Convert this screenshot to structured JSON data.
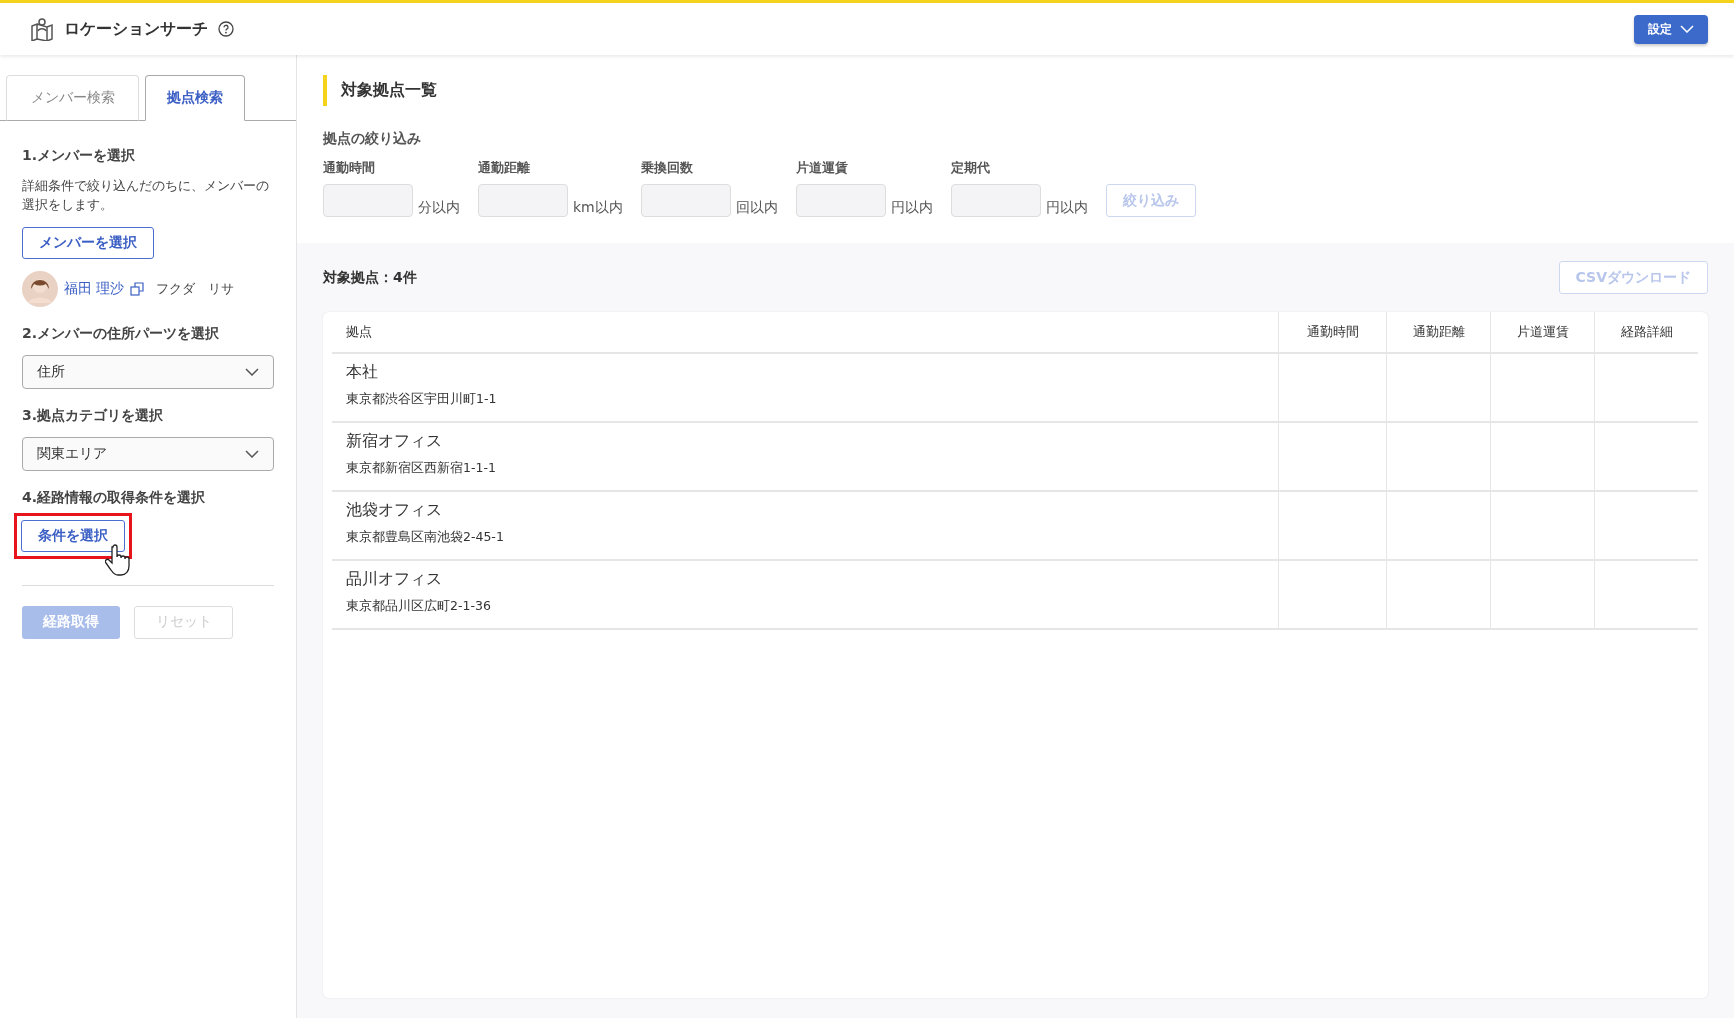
{
  "header": {
    "title": "ロケーションサーチ",
    "settings_button": "設定"
  },
  "tabs": [
    {
      "label": "メンバー検索",
      "selected": false
    },
    {
      "label": "拠点検索",
      "selected": true
    }
  ],
  "steps": [
    {
      "kind": "member",
      "title": "1.メンバーを選択",
      "description": "詳細条件で絞り込んだのちに、メンバーの選択をします。",
      "button": "メンバーを選択",
      "member": {
        "name": "福田 理沙",
        "kana": "フクダ　リサ"
      }
    },
    {
      "kind": "select",
      "title": "2.メンバーの住所パーツを選択",
      "value": "住所"
    },
    {
      "kind": "select",
      "title": "3.拠点カテゴリを選択",
      "value": "関東エリア"
    },
    {
      "kind": "condition",
      "title": "4.経路情報の取得条件を選択",
      "button": "条件を選択",
      "highlighted": true
    }
  ],
  "actions": [
    {
      "label": "経路取得",
      "kind": "primary",
      "disabled": true
    },
    {
      "label": "リセット",
      "kind": "secondary",
      "disabled": true
    }
  ],
  "main": {
    "title": "対象拠点一覧",
    "filter_title": "拠点の絞り込み",
    "filters": [
      {
        "label": "通勤時間",
        "unit": "分以内"
      },
      {
        "label": "通勤距離",
        "unit": "km以内"
      },
      {
        "label": "乗換回数",
        "unit": "回以内"
      },
      {
        "label": "片道運賃",
        "unit": "円以内"
      },
      {
        "label": "定期代",
        "unit": "円以内"
      }
    ],
    "filter_button": {
      "label": "絞り込み",
      "disabled": true
    },
    "count": "対象拠点：4件",
    "csv_button": {
      "label": "CSVダウンロード",
      "disabled": true
    },
    "table": {
      "columns": [
        "拠点",
        "通勤時間",
        "通勤距離",
        "片道運賃",
        "経路詳細"
      ],
      "rows": [
        {
          "name": "本社",
          "address": "東京都渋谷区宇田川町1-1"
        },
        {
          "name": "新宿オフィス",
          "address": "東京都新宿区西新宿1-1-1"
        },
        {
          "name": "池袋オフィス",
          "address": "東京都豊島区南池袋2-45-1"
        },
        {
          "name": "品川オフィス",
          "address": "東京都品川区広町2-1-36"
        }
      ]
    }
  }
}
